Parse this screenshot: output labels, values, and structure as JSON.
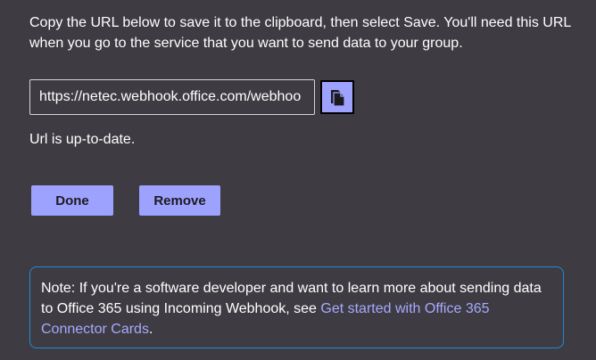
{
  "instructions": "Copy the URL below to save it to the clipboard, then select Save. You'll need this URL when you go to the service that you want to send data to your group.",
  "url_field": {
    "value": "https://netec.webhook.office.com/webhoo"
  },
  "copy_button": {
    "icon": "copy-icon"
  },
  "status_text": "Url is up-to-date.",
  "buttons": {
    "done_label": "Done",
    "remove_label": "Remove"
  },
  "note": {
    "prefix": "Note: If you're a software developer and want to learn more about sending data to Office 365 using Incoming Webhook, see ",
    "link_text": "Get started with Office 365 Connector Cards",
    "suffix": "."
  },
  "colors": {
    "background": "#3e3c42",
    "accent": "#9ea2ff",
    "link": "#a6a9ff",
    "note_border": "#1f8ad6"
  }
}
